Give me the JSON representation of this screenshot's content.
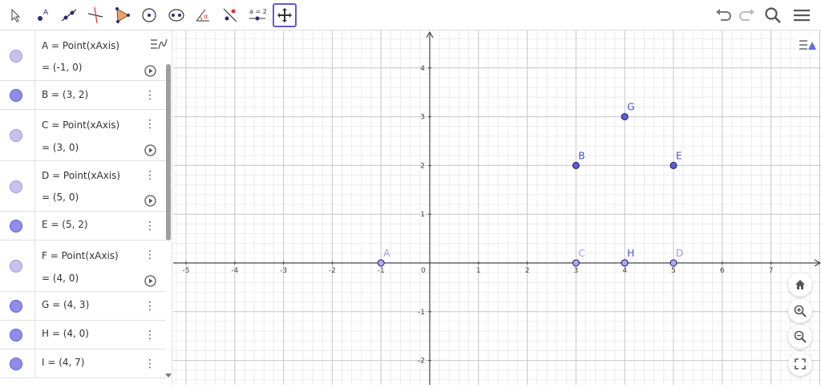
{
  "toolbar": {
    "tools": [
      {
        "name": "move-icon"
      },
      {
        "name": "point-icon",
        "label": "A"
      },
      {
        "name": "line-icon"
      },
      {
        "name": "perpendicular-line-icon"
      },
      {
        "name": "polygon-icon"
      },
      {
        "name": "circle-center-icon"
      },
      {
        "name": "ellipse-icon"
      },
      {
        "name": "angle-icon",
        "label": "α"
      },
      {
        "name": "reflect-icon"
      },
      {
        "name": "slider-icon",
        "label": "a = 2"
      },
      {
        "name": "move-graphics-icon"
      }
    ],
    "right": [
      "undo-icon",
      "redo-icon",
      "search-icon",
      "hamburger-menu-icon"
    ]
  },
  "algebra": {
    "rows": [
      {
        "lines": [
          "A = Point(xAxis)",
          "= (-1, 0)"
        ],
        "playable": true
      },
      {
        "lines": [
          "B = (3, 2)"
        ],
        "playable": false
      },
      {
        "lines": [
          "C = Point(xAxis)",
          "= (3, 0)"
        ],
        "playable": true
      },
      {
        "lines": [
          "D = Point(xAxis)",
          "= (5, 0)"
        ],
        "playable": true
      },
      {
        "lines": [
          "E = (5, 2)"
        ],
        "playable": false
      },
      {
        "lines": [
          "F = Point(xAxis)",
          "= (4, 0)"
        ],
        "playable": true
      },
      {
        "lines": [
          "G = (4, 3)"
        ],
        "playable": false
      },
      {
        "lines": [
          "H = (4, 0)"
        ],
        "playable": false
      },
      {
        "lines": [
          "I = (4, 7)"
        ],
        "playable": false
      }
    ]
  },
  "graph": {
    "x_ticks": [
      "-5",
      "-4",
      "-3",
      "-2",
      "-1",
      "0",
      "1",
      "2",
      "3",
      "4",
      "5",
      "6",
      "7"
    ],
    "y_ticks": [
      "4",
      "3",
      "2",
      "1",
      "-1",
      "-2"
    ],
    "xlim": [
      -5.1,
      8.1
    ],
    "ylim": [
      -2.5,
      4.8
    ],
    "points": [
      {
        "label": "A",
        "x": -1,
        "y": 0,
        "free": true
      },
      {
        "label": "B",
        "x": 3,
        "y": 2,
        "free": false
      },
      {
        "label": "C",
        "x": 3,
        "y": 0,
        "free": true
      },
      {
        "label": "D",
        "x": 5,
        "y": 0,
        "free": true
      },
      {
        "label": "E",
        "x": 5,
        "y": 2,
        "free": false
      },
      {
        "label": "G",
        "x": 4,
        "y": 3,
        "free": false
      },
      {
        "label": "H",
        "x": 4,
        "y": 0,
        "free": false
      },
      {
        "label": "F",
        "x": 4,
        "y": 0,
        "free": true
      }
    ],
    "colors": {
      "point_fill": "#5c5ce0",
      "free_fill": "#aaa8f0",
      "stroke": "#1a1a66",
      "label": "#4d4dcc",
      "grid_major": "#c9c9c9",
      "grid_minor": "#ececec"
    }
  },
  "side_buttons": [
    "home-icon",
    "zoom-in-icon",
    "zoom-out-icon",
    "fullscreen-icon"
  ]
}
